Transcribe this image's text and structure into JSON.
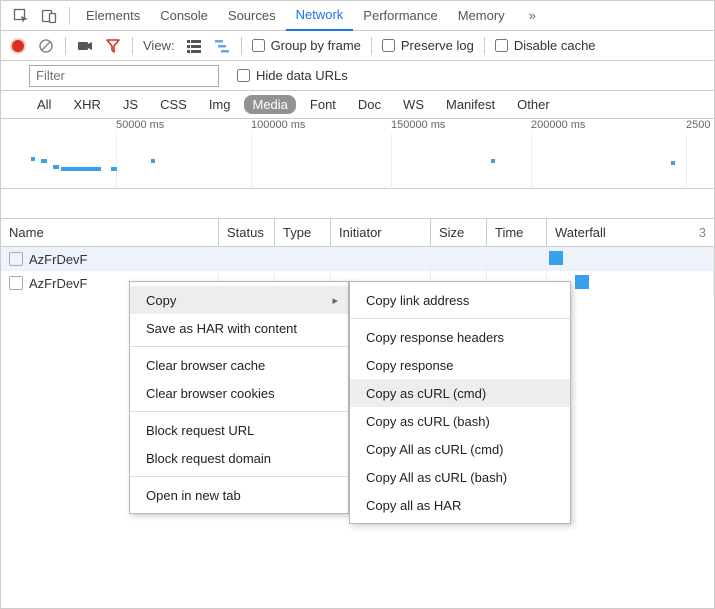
{
  "tabs": {
    "items": [
      "Elements",
      "Console",
      "Sources",
      "Network",
      "Performance",
      "Memory"
    ],
    "active": "Network"
  },
  "toolbar": {
    "view_label": "View:",
    "group_by_frame": "Group by frame",
    "preserve_log": "Preserve log",
    "disable_cache": "Disable cache"
  },
  "filter": {
    "placeholder": "Filter",
    "hide_data_urls": "Hide data URLs"
  },
  "types": {
    "items": [
      "All",
      "XHR",
      "JS",
      "CSS",
      "Img",
      "Media",
      "Font",
      "Doc",
      "WS",
      "Manifest",
      "Other"
    ],
    "active": "Media"
  },
  "timeline": {
    "ticks": [
      "50000 ms",
      "100000 ms",
      "150000 ms",
      "200000 ms",
      "2500"
    ]
  },
  "columns": {
    "name": "Name",
    "status": "Status",
    "type": "Type",
    "initiator": "Initiator",
    "size": "Size",
    "time": "Time",
    "waterfall": "Waterfall",
    "waterfall_right": "3"
  },
  "rows": [
    {
      "name": "AzFrDevF"
    },
    {
      "name": "AzFrDevF"
    }
  ],
  "context_menu": {
    "main": [
      {
        "label": "Copy",
        "submenu": true,
        "hover": true
      },
      {
        "label": "Save as HAR with content"
      },
      {
        "sep": true
      },
      {
        "label": "Clear browser cache"
      },
      {
        "label": "Clear browser cookies"
      },
      {
        "sep": true
      },
      {
        "label": "Block request URL"
      },
      {
        "label": "Block request domain"
      },
      {
        "sep": true
      },
      {
        "label": "Open in new tab"
      }
    ],
    "sub": [
      {
        "label": "Copy link address"
      },
      {
        "sep": true
      },
      {
        "label": "Copy response headers"
      },
      {
        "label": "Copy response"
      },
      {
        "label": "Copy as cURL (cmd)",
        "hover": true
      },
      {
        "label": "Copy as cURL (bash)"
      },
      {
        "label": "Copy All as cURL (cmd)"
      },
      {
        "label": "Copy All as cURL (bash)"
      },
      {
        "label": "Copy all as HAR"
      }
    ]
  }
}
